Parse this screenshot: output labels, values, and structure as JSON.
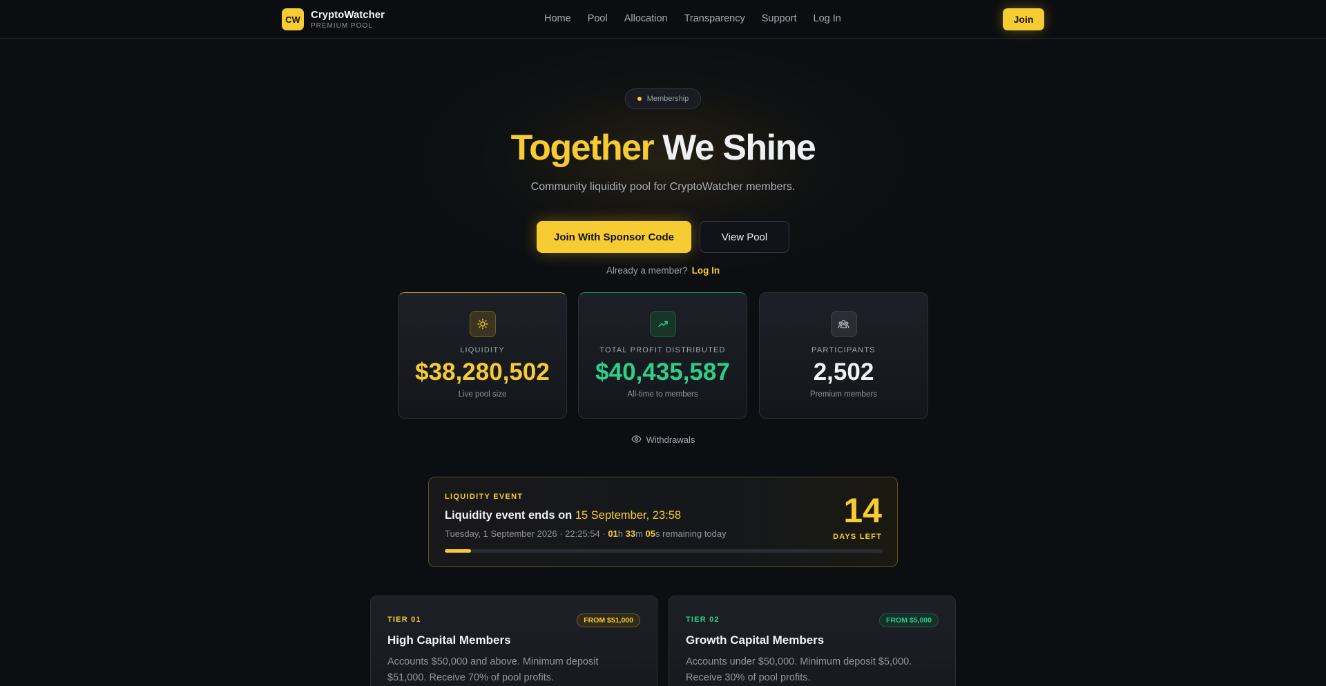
{
  "nav": {
    "logo": "CW",
    "brand_name": "CryptoWatcher",
    "brand_sub": "PREMIUM POOL",
    "links": [
      "Home",
      "Pool",
      "Allocation",
      "Transparency",
      "Support",
      "Log In"
    ],
    "join_label": "Join"
  },
  "hero": {
    "badge": "Membership",
    "title_highlight": "Together",
    "title_rest": " We Shine",
    "subtitle": "Community liquidity pool for CryptoWatcher members.",
    "primary_cta": "Join With Sponsor Code",
    "secondary_cta": "View Pool",
    "member_prompt": "Already a member?",
    "member_link": "Log In"
  },
  "stats": [
    {
      "icon": "sun-icon",
      "label": "LIQUIDITY",
      "value": "$38,280,502",
      "note": "Live pool size"
    },
    {
      "icon": "trending-up-icon",
      "label": "TOTAL PROFIT DISTRIBUTED",
      "value": "$40,435,587",
      "note": "All-time to members"
    },
    {
      "icon": "users-icon",
      "label": "PARTICIPANTS",
      "value": "2,502",
      "note": "Premium members"
    }
  ],
  "withdrawals_label": "Withdrawals",
  "event": {
    "kicker": "LIQUIDITY EVENT",
    "title_prefix": "Liquidity event ends on ",
    "title_date": "15 September, 23:58",
    "time_prefix": "Tuesday, 1 September 2026 · 22:25:54 · ",
    "hours": "01",
    "minutes": "33",
    "seconds": "05",
    "time_suffix": "s remaining today",
    "days_number": "14",
    "days_label": "DAYS LEFT",
    "progress_fraction": 0.06
  },
  "tiers": [
    {
      "kicker": "TIER 01",
      "badge": "FROM $51,000",
      "title": "High Capital Members",
      "desc": "Accounts $50,000 and above. Minimum deposit $51,000. Receive 70% of pool profits."
    },
    {
      "kicker": "TIER 02",
      "badge": "FROM $5,000",
      "title": "Growth Capital Members",
      "desc": "Accounts under $50,000. Minimum deposit $5,000. Receive 30% of pool profits."
    }
  ],
  "colors": {
    "accent": "#f7cc32",
    "green": "#2dd08a",
    "background": "#0c0e12"
  }
}
